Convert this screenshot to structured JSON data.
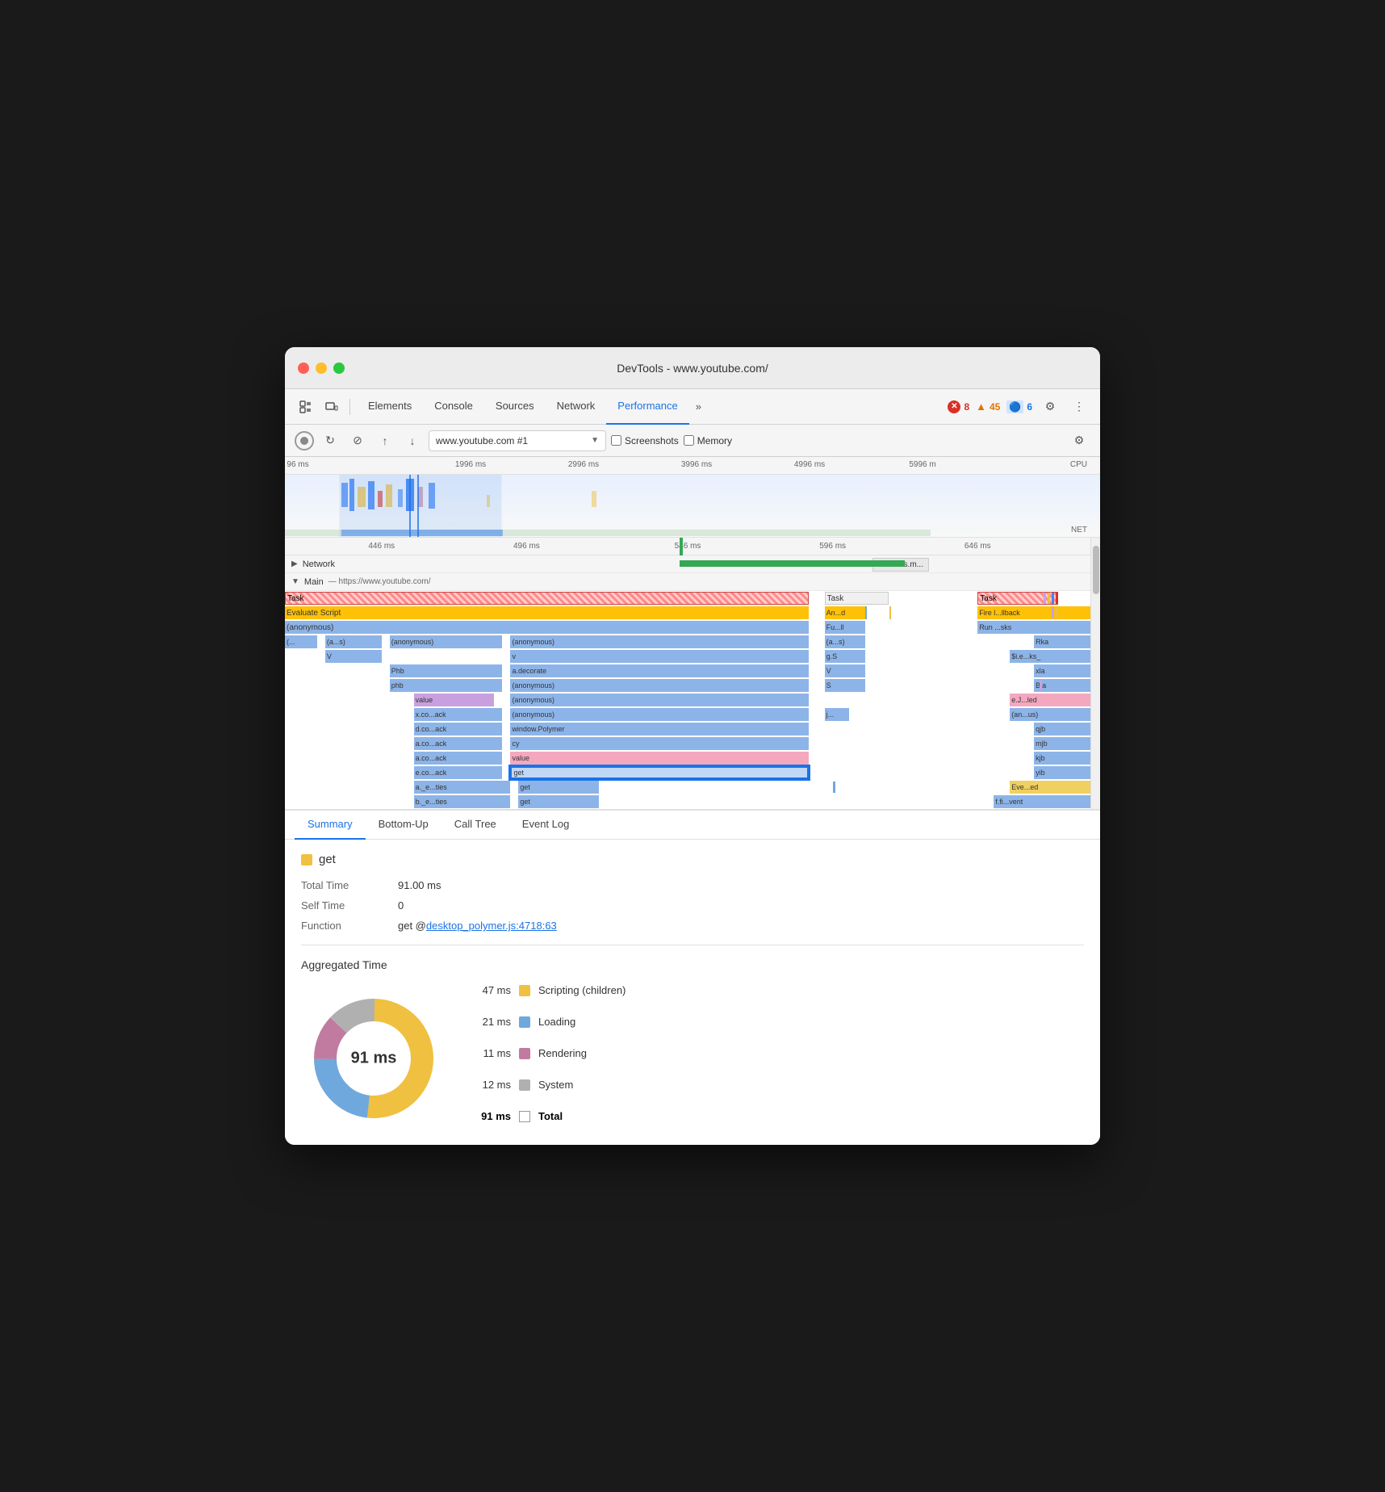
{
  "window": {
    "title": "DevTools - www.youtube.com/"
  },
  "trafficLights": [
    "red",
    "yellow",
    "green"
  ],
  "tabs": [
    {
      "label": "Elements",
      "active": false
    },
    {
      "label": "Console",
      "active": false
    },
    {
      "label": "Sources",
      "active": false
    },
    {
      "label": "Network",
      "active": false
    },
    {
      "label": "Performance",
      "active": true
    },
    {
      "label": "»",
      "active": false
    }
  ],
  "badges": {
    "errors": {
      "icon": "✕",
      "count": "8",
      "color": "red"
    },
    "warnings": {
      "icon": "▲",
      "count": "45",
      "color": "yellow"
    },
    "info": {
      "icon": "🔵",
      "count": "6",
      "color": "blue"
    }
  },
  "toolbar2": {
    "url": "www.youtube.com #1",
    "screenshots": "Screenshots",
    "memory": "Memory"
  },
  "ruler": {
    "marks": [
      "96 ms",
      "1996 ms",
      "2996 ms",
      "3996 ms",
      "4996 ms",
      "5996 m"
    ],
    "cpu": "CPU",
    "net": "NET"
  },
  "flameRuler": {
    "marks": [
      "446 ms",
      "496 ms",
      "546 ms",
      "596 ms",
      "646 ms"
    ]
  },
  "networkRow": {
    "label": "Network",
    "successBadge": "success.m..."
  },
  "mainRow": {
    "label": "Main",
    "url": "— https://www.youtube.com/"
  },
  "flameRows": [
    {
      "label": "Task",
      "type": "task-red",
      "right": [
        "Task",
        "Task"
      ]
    },
    {
      "label": "Evaluate Script",
      "type": "evaluate",
      "right": [
        "An...d",
        "Fire l...llback"
      ]
    },
    {
      "label": "(anonymous)",
      "type": "anonymous",
      "right": [
        "Fu...ll",
        "Run ...sks"
      ]
    },
    {
      "label": "(...",
      "type": "anonymous",
      "sub": [
        "(a...s)",
        "(anonymous)",
        "(anonymous)"
      ],
      "right": [
        "(a...s)",
        "Rka"
      ]
    },
    {
      "label": "V",
      "type": "anonymous",
      "sub": [
        "v"
      ],
      "right": [
        "g.S",
        "$i.e...ks_"
      ]
    },
    {
      "label": "Phb",
      "type": "anonymous",
      "sub": [
        "a.decorate"
      ],
      "right": [
        "V",
        "xla"
      ]
    },
    {
      "label": "phb",
      "type": "anonymous",
      "sub": [
        "(anonymous)"
      ],
      "right": [
        "S",
        "Bla"
      ]
    },
    {
      "label": "value",
      "type": "purple",
      "sub": [
        "(anonymous)"
      ],
      "right": [
        "",
        "e.J...led"
      ]
    },
    {
      "label": "x.co...ack",
      "type": "anonymous",
      "sub": [
        "(anonymous)"
      ],
      "right": [
        "j...",
        "(an...us)"
      ]
    },
    {
      "label": "d.co...ack",
      "type": "anonymous",
      "sub": [
        "window.Polymer"
      ],
      "right": [
        "",
        "qjb"
      ]
    },
    {
      "label": "a.co...ack",
      "type": "anonymous",
      "sub": [
        "cy"
      ],
      "right": [
        "",
        "mjb"
      ]
    },
    {
      "label": "a.co...ack",
      "type": "anonymous",
      "sub": [
        "value"
      ],
      "right": [
        "",
        "kjb"
      ]
    },
    {
      "label": "e.co...ack",
      "type": "selected",
      "sub": [
        "get"
      ],
      "right": [
        "",
        "yib"
      ]
    },
    {
      "label": "a._e...ties",
      "type": "anonymous",
      "sub": [
        "get"
      ],
      "right": [
        "",
        "Eve...ed"
      ]
    },
    {
      "label": "b._e...ties",
      "type": "anonymous",
      "sub": [
        "get"
      ],
      "right": [
        "",
        "f.fi...vent"
      ]
    }
  ],
  "bottomTabs": [
    {
      "label": "Summary",
      "active": true
    },
    {
      "label": "Bottom-Up",
      "active": false
    },
    {
      "label": "Call Tree",
      "active": false
    },
    {
      "label": "Event Log",
      "active": false
    }
  ],
  "summary": {
    "functionName": "get",
    "functionColor": "#f0c040",
    "totalTime": {
      "label": "Total Time",
      "value": "91.00 ms"
    },
    "selfTime": {
      "label": "Self Time",
      "value": "0"
    },
    "function": {
      "label": "Function",
      "prefix": "get @ ",
      "link": "desktop_polymer.js:4718:63"
    }
  },
  "aggregated": {
    "title": "Aggregated Time",
    "items": [
      {
        "ms": "47 ms",
        "color": "#f0c040",
        "label": "Scripting (children)"
      },
      {
        "ms": "21 ms",
        "color": "#6fa8dc",
        "label": "Loading"
      },
      {
        "ms": "11 ms",
        "color": "#c27ba0",
        "label": "Rendering"
      },
      {
        "ms": "12 ms",
        "color": "#b0b0b0",
        "label": "System"
      }
    ],
    "total": {
      "ms": "91 ms",
      "label": "Total"
    },
    "donut": {
      "center": "91 ms",
      "segments": [
        {
          "color": "#f0c040",
          "pct": 51.6,
          "label": "Scripting"
        },
        {
          "color": "#6fa8dc",
          "pct": 23.1,
          "label": "Loading"
        },
        {
          "color": "#c27ba0",
          "pct": 12.1,
          "label": "Rendering"
        },
        {
          "color": "#b0b0b0",
          "pct": 13.2,
          "label": "System"
        }
      ]
    }
  }
}
